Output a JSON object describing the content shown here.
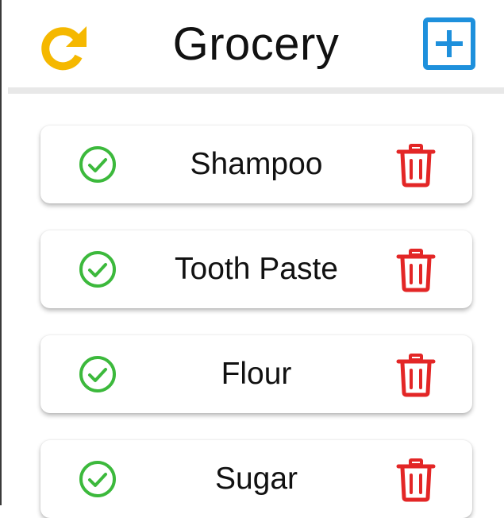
{
  "header": {
    "title": "Grocery",
    "refresh_icon": "refresh-icon",
    "add_icon": "plus-square-icon"
  },
  "items": [
    {
      "label": "Shampoo",
      "check_icon": "check-circle-icon",
      "delete_icon": "trash-icon"
    },
    {
      "label": "Tooth Paste",
      "check_icon": "check-circle-icon",
      "delete_icon": "trash-icon"
    },
    {
      "label": "Flour",
      "check_icon": "check-circle-icon",
      "delete_icon": "trash-icon"
    },
    {
      "label": "Sugar",
      "check_icon": "check-circle-icon",
      "delete_icon": "trash-icon"
    }
  ],
  "colors": {
    "refresh": "#f5b800",
    "add": "#1e90dc",
    "check": "#3cb93c",
    "delete": "#e32626"
  }
}
